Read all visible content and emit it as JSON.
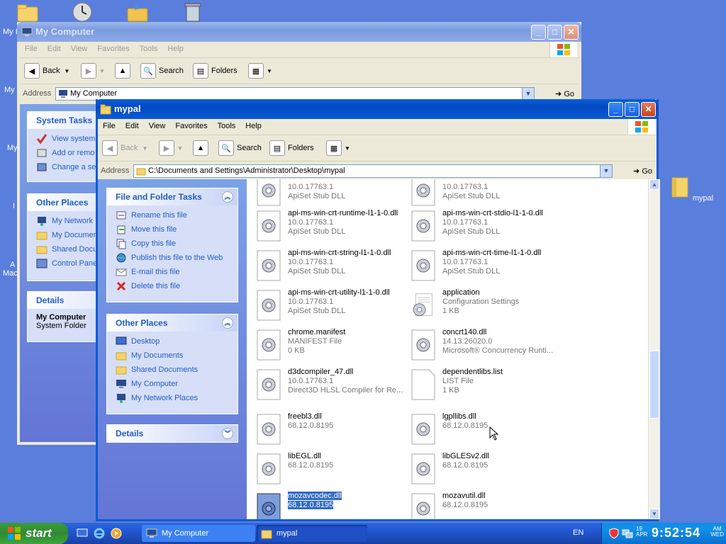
{
  "desktop": {
    "labels": [
      "My I",
      "My",
      "My",
      "I",
      "A",
      "Mac"
    ],
    "mypal_icon_label": "mypal"
  },
  "back_window": {
    "title": "My Computer",
    "menu": [
      "File",
      "Edit",
      "View",
      "Favorites",
      "Tools",
      "Help"
    ],
    "toolbar": {
      "back": "Back",
      "search": "Search",
      "folders": "Folders"
    },
    "address_label": "Address",
    "address_value": "My Computer",
    "go": "Go",
    "system_tasks": {
      "title": "System Tasks",
      "items": [
        "View system",
        "Add or remo",
        "Change a se"
      ]
    },
    "other_places": {
      "title": "Other Places",
      "items": [
        "My Network",
        "My Documen",
        "Shared Docu",
        "Control Pane"
      ]
    },
    "details": {
      "title": "Details",
      "name": "My Computer",
      "desc": "System Folder"
    }
  },
  "front_window": {
    "title": "mypal",
    "menu": [
      "File",
      "Edit",
      "View",
      "Favorites",
      "Tools",
      "Help"
    ],
    "toolbar": {
      "back": "Back",
      "search": "Search",
      "folders": "Folders"
    },
    "address_label": "Address",
    "address_value": "C:\\Documents and Settings\\Administrator\\Desktop\\mypal",
    "go": "Go",
    "file_tasks": {
      "title": "File and Folder Tasks",
      "items": [
        "Rename this file",
        "Move this file",
        "Copy this file",
        "Publish this file to the Web",
        "E-mail this file",
        "Delete this file"
      ]
    },
    "other_places": {
      "title": "Other Places",
      "items": [
        "Desktop",
        "My Documents",
        "Shared Documents",
        "My Computer",
        "My Network Places"
      ]
    },
    "details": {
      "title": "Details"
    },
    "files": [
      {
        "name": "",
        "l2": "10.0.17763.1",
        "l3": "ApiSet Stub DLL"
      },
      {
        "name": "",
        "l2": "10.0.17763.1",
        "l3": "ApiSet Stub DLL"
      },
      {
        "name": "api-ms-win-crt-runtime-l1-1-0.dll",
        "l2": "10.0.17763.1",
        "l3": "ApiSet Stub DLL"
      },
      {
        "name": "api-ms-win-crt-stdio-l1-1-0.dll",
        "l2": "10.0.17763.1",
        "l3": "ApiSet Stub DLL"
      },
      {
        "name": "api-ms-win-crt-string-l1-1-0.dll",
        "l2": "10.0.17763.1",
        "l3": "ApiSet Stub DLL"
      },
      {
        "name": "api-ms-win-crt-time-l1-1-0.dll",
        "l2": "10.0.17763.1",
        "l3": "ApiSet Stub DLL"
      },
      {
        "name": "api-ms-win-crt-utility-l1-1-0.dll",
        "l2": "10.0.17763.1",
        "l3": "ApiSet Stub DLL"
      },
      {
        "name": "application",
        "l2": "Configuration Settings",
        "l3": "1 KB"
      },
      {
        "name": "chrome.manifest",
        "l2": "MANIFEST File",
        "l3": "0 KB"
      },
      {
        "name": "concrt140.dll",
        "l2": "14.13.26020.0",
        "l3": "Microsoft® Concurrency Runti..."
      },
      {
        "name": "d3dcompiler_47.dll",
        "l2": "10.0.17763.1",
        "l3": "Direct3D HLSL Compiler for Re..."
      },
      {
        "name": "dependentlibs.list",
        "l2": "LIST File",
        "l3": "1 KB"
      },
      {
        "name": "freebl3.dll",
        "l2": "68.12.0.8195",
        "l3": ""
      },
      {
        "name": "lgpllibs.dll",
        "l2": "68.12.0.8195",
        "l3": ""
      },
      {
        "name": "libEGL.dll",
        "l2": "68.12.0.8195",
        "l3": ""
      },
      {
        "name": "libGLESv2.dll",
        "l2": "68.12.0.8195",
        "l3": ""
      },
      {
        "name": "mozavcodec.dll",
        "l2": "68.12.0.8195",
        "l3": ""
      },
      {
        "name": "mozavutil.dll",
        "l2": "68.12.0.8195",
        "l3": ""
      }
    ]
  },
  "taskbar": {
    "start": "start",
    "tasks": [
      "My Computer",
      "mypal"
    ],
    "lang": "EN",
    "date_line1": "19",
    "date_line2": "APR",
    "time": "9:52:54",
    "ampm": "AM",
    "day": "WED"
  },
  "colors": {
    "accent": "#0a5fd8",
    "panel_link": "#215dc6",
    "selection": "#316ac5"
  }
}
